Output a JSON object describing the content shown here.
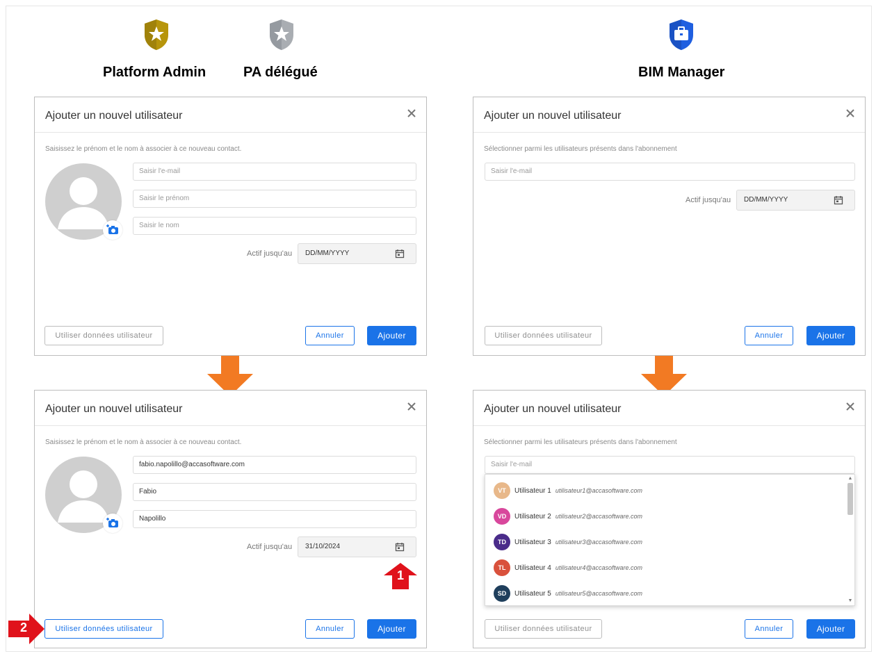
{
  "roles": {
    "platform_admin": "Platform Admin",
    "pa_delegue": "PA délégué",
    "bim_manager": "BIM Manager"
  },
  "colors": {
    "gold_badge": "#b7950b",
    "silver_badge": "#a9adb2",
    "blue_badge": "#1f5fe0",
    "accent_blue": "#1a73e8",
    "orange_arrow": "#f27a23",
    "red_marker": "#e0121b"
  },
  "dialogs": {
    "d1": {
      "title": "Ajouter un nouvel utilisateur",
      "subtitle": "Saisissez le prénom et le nom à associer à ce nouveau contact.",
      "email_placeholder": "Saisir l'e-mail",
      "firstname_placeholder": "Saisir le prénom",
      "lastname_placeholder": "Saisir le nom",
      "date_label": "Actif jusqu'au",
      "date_value": "DD/MM/YYYY",
      "use_data_label": "Utiliser données utilisateur",
      "cancel_label": "Annuler",
      "add_label": "Ajouter"
    },
    "d2": {
      "title": "Ajouter un nouvel utilisateur",
      "subtitle": "Sélectionner parmi les utilisateurs présents dans l'abonnement",
      "email_placeholder": "Saisir l'e-mail",
      "date_label": "Actif jusqu'au",
      "date_value": "DD/MM/YYYY",
      "use_data_label": "Utiliser données utilisateur",
      "cancel_label": "Annuler",
      "add_label": "Ajouter"
    },
    "d3": {
      "title": "Ajouter un nouvel utilisateur",
      "subtitle": "Saisissez le prénom et le nom à associer à ce nouveau contact.",
      "email_value": "fabio.napolillo@accasoftware.com",
      "firstname_value": "Fabio",
      "lastname_value": "Napolillo",
      "date_label": "Actif jusqu'au",
      "date_value": "31/10/2024",
      "use_data_label": "Utiliser données utilisateur",
      "cancel_label": "Annuler",
      "add_label": "Ajouter"
    },
    "d4": {
      "title": "Ajouter un nouvel utilisateur",
      "subtitle": "Sélectionner parmi les utilisateurs présents dans l'abonnement",
      "email_placeholder": "Saisir l'e-mail",
      "use_data_label": "Utiliser données utilisateur",
      "cancel_label": "Annuler",
      "add_label": "Ajouter",
      "users": [
        {
          "initials": "VT",
          "name": "Utilisateur 1",
          "email": "utilisateur1@accasoftware.com",
          "color": "#e8b88a"
        },
        {
          "initials": "VD",
          "name": "Utilisateur 2",
          "email": "utilisateur2@accasoftware.com",
          "color": "#d8479c"
        },
        {
          "initials": "TD",
          "name": "Utilisateur 3",
          "email": "utilisateur3@accasoftware.com",
          "color": "#4a2c8a"
        },
        {
          "initials": "TL",
          "name": "Utilisateur 4",
          "email": "utilisateur4@accasoftware.com",
          "color": "#d9513c"
        },
        {
          "initials": "SD",
          "name": "Utilisateur 5",
          "email": "utilisateur5@accasoftware.com",
          "color": "#1f3f5c"
        }
      ]
    }
  },
  "markers": {
    "step1": "1",
    "step2": "2"
  }
}
